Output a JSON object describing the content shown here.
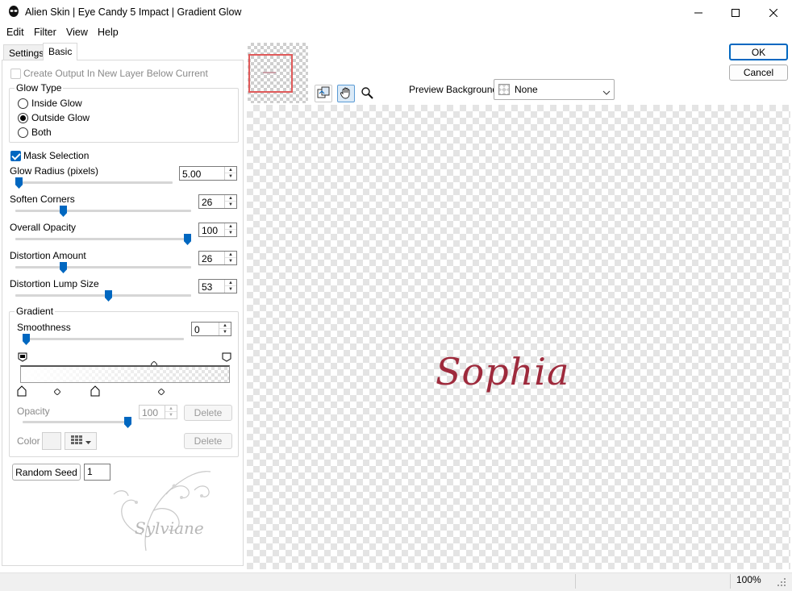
{
  "window": {
    "title": "Alien Skin | Eye Candy 5 Impact | Gradient Glow"
  },
  "menu": {
    "items": [
      {
        "label": "Edit",
        "accel": "E"
      },
      {
        "label": "Filter",
        "accel": "F"
      },
      {
        "label": "View",
        "accel": "V"
      },
      {
        "label": "Help",
        "accel": "H"
      }
    ]
  },
  "tabs": {
    "settings": "Settings",
    "basic": "Basic",
    "active": "Basic"
  },
  "basic": {
    "create_output_label": "Create Output In New Layer Below Current",
    "create_output_checked": false,
    "glow_type": {
      "title": "Glow Type",
      "options": [
        "Inside Glow",
        "Outside Glow",
        "Both"
      ],
      "selected": "Outside Glow"
    },
    "mask_selection_label": "Mask Selection",
    "mask_selection_checked": true,
    "sliders": [
      {
        "label": "Glow Radius (pixels)",
        "value": "5.00",
        "fraction": 0.0
      },
      {
        "label": "Soften Corners",
        "value": "26",
        "fraction": 0.26
      },
      {
        "label": "Overall Opacity",
        "value": "100",
        "fraction": 1.0
      },
      {
        "label": "Distortion Amount",
        "value": "26",
        "fraction": 0.26
      },
      {
        "label": "Distortion Lump Size",
        "value": "53",
        "fraction": 0.53
      }
    ],
    "gradient": {
      "title": "Gradient",
      "smoothness_label": "Smoothness",
      "smoothness_value": "0",
      "opacity_label": "Opacity",
      "opacity_value": "100",
      "color_label": "Color",
      "delete_label": "Delete"
    },
    "random_seed_label": "Random Seed",
    "random_seed_value": "1"
  },
  "buttons": {
    "ok": "OK",
    "cancel": "Cancel"
  },
  "preview": {
    "background_label": "Preview Background:",
    "background_value": "None",
    "sample_text": "Sophia",
    "text_color": "#9e2a3c",
    "watermark_text": "Sylviane"
  },
  "status": {
    "zoom": "100%"
  },
  "colors": {
    "accent": "#0067c0",
    "thumb_frame": "#e05a5a"
  }
}
